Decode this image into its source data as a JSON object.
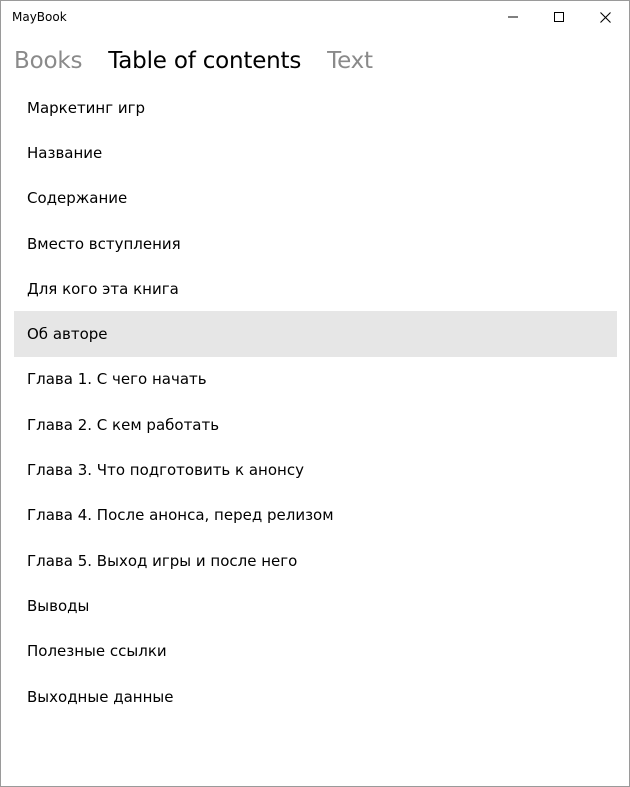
{
  "window": {
    "title": "MayBook",
    "minimize_icon": "minimize-icon",
    "maximize_icon": "maximize-icon",
    "close_icon": "close-icon"
  },
  "pivot": {
    "tabs": [
      {
        "label": "Books",
        "active": false
      },
      {
        "label": "Table of contents",
        "active": true
      },
      {
        "label": "Text",
        "active": false
      }
    ]
  },
  "toc": {
    "selected_index": 5,
    "items": [
      {
        "label": "Маркетинг игр"
      },
      {
        "label": "Название"
      },
      {
        "label": "Содержание"
      },
      {
        "label": "Вместо вступления"
      },
      {
        "label": "Для кого эта книга"
      },
      {
        "label": "Об авторе"
      },
      {
        "label": "Глава 1. С чего начать"
      },
      {
        "label": "Глава 2. С кем работать"
      },
      {
        "label": "Глава 3. Что подготовить к анонсу"
      },
      {
        "label": "Глава 4. После анонса, перед релизом"
      },
      {
        "label": "Глава 5. Выход игры и после него"
      },
      {
        "label": "Выводы"
      },
      {
        "label": "Полезные ссылки"
      },
      {
        "label": "Выходные данные"
      }
    ]
  },
  "colors": {
    "selected_row": "#e6e6e6",
    "inactive_tab": "#8a8a8a",
    "text": "#000000",
    "window_border": "#9a9a9a"
  }
}
